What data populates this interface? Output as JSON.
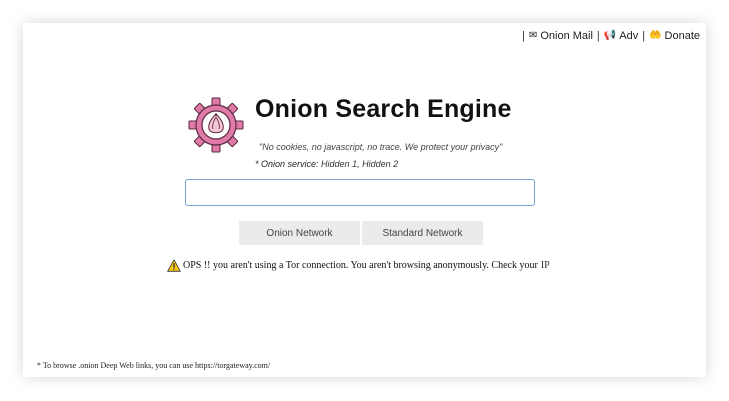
{
  "topnav": {
    "separator": "|",
    "onion_mail": {
      "label": "Onion Mail",
      "icon": "envelope-icon"
    },
    "adv": {
      "label": "Adv",
      "icon": "megaphone-icon"
    },
    "donate": {
      "label": "Donate",
      "icon": "coin-hand-icon"
    }
  },
  "brand": {
    "title": "Onion Search Engine",
    "slogan": "\"No cookies, no javascript, no trace. We protect your privacy\"",
    "onion_service_label": "* Onion service:",
    "hidden_1": "Hidden 1",
    "hidden_2": "Hidden 2",
    "comma": ",",
    "logo_colors": {
      "gear": "#e07aa8",
      "onion": "#f5c7d8",
      "outline": "#5a2a3c"
    }
  },
  "search": {
    "value": "",
    "placeholder": ""
  },
  "buttons": {
    "onion_network": "Onion Network",
    "standard_network": "Standard Network"
  },
  "warning": {
    "text": "OPS !! you aren't using a Tor connection. You aren't browsing anonymously. Check your",
    "link": "IP",
    "icon": "warning-triangle-icon"
  },
  "footnote": {
    "text": "* To browse .onion Deep Web links, you can use",
    "link": "https://torgateway.com/"
  }
}
